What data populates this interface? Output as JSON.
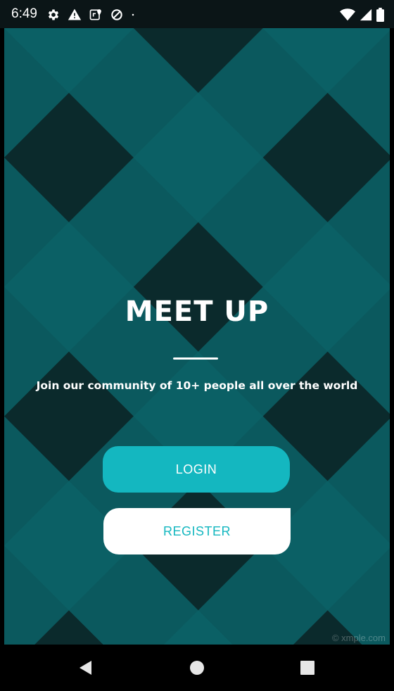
{
  "status_bar": {
    "time": "6:49",
    "left_icons": [
      "gear-icon",
      "warning-icon",
      "maps-icon",
      "data-saver-icon",
      "dot-icon"
    ],
    "right_icons": [
      "wifi-icon",
      "signal-icon",
      "battery-icon"
    ]
  },
  "main": {
    "title": "MEET UP",
    "tagline": "Join our community of 10+ people all over the world",
    "login_label": "LOGIN",
    "register_label": "REGISTER",
    "watermark": "© xmple.com"
  },
  "nav_bar": {
    "icons": [
      "back-icon",
      "home-icon",
      "recents-icon"
    ]
  },
  "colors": {
    "accent": "#14b7c0",
    "background_dark": "#0b2a2c",
    "stripe_mid": "#0b6266",
    "stripe_light": "#0c8287",
    "text_light": "#ffffff"
  }
}
